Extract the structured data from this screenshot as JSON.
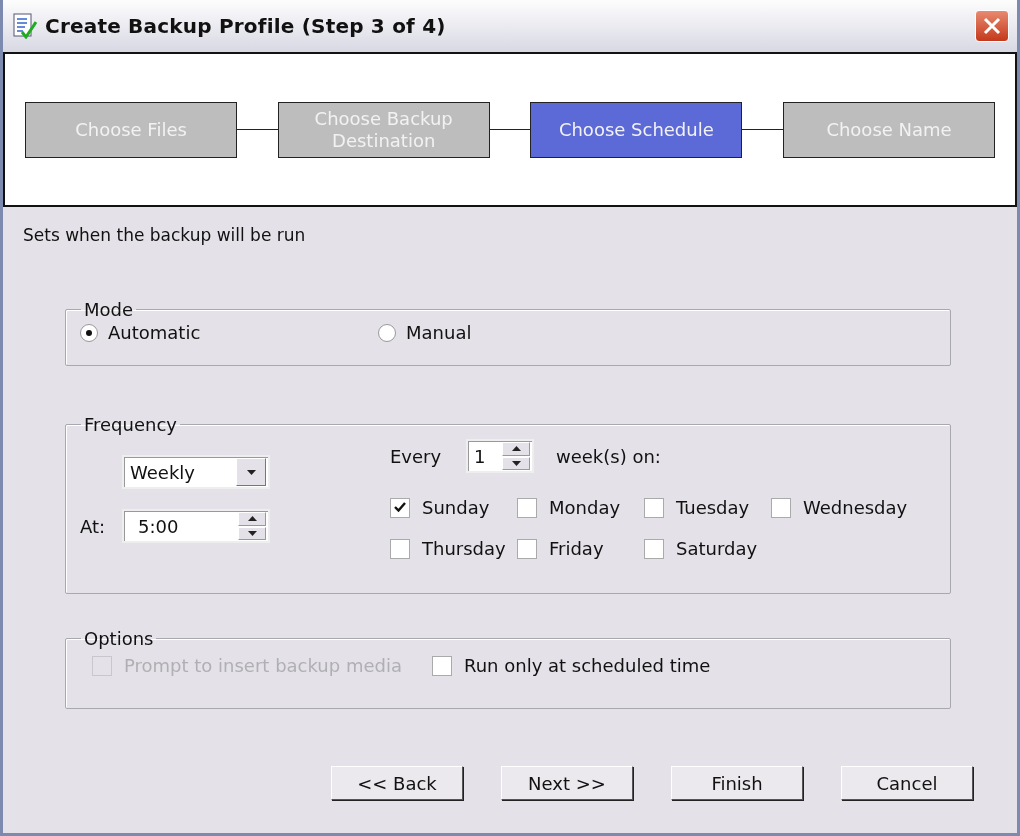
{
  "window": {
    "title": "Create Backup Profile (Step 3 of 4)"
  },
  "steps": [
    {
      "label": "Choose Files",
      "selected": false
    },
    {
      "label": "Choose Backup Destination",
      "selected": false
    },
    {
      "label": "Choose Schedule",
      "selected": true
    },
    {
      "label": "Choose Name",
      "selected": false
    }
  ],
  "description": "Sets when the backup will be run",
  "mode": {
    "title": "Mode",
    "options": [
      {
        "label": "Automatic",
        "selected": true
      },
      {
        "label": "Manual",
        "selected": false
      }
    ]
  },
  "frequency": {
    "title": "Frequency",
    "period": "Weekly",
    "at_label": "At:",
    "time": "5:00",
    "every_label": "Every",
    "every_value": "1",
    "unit_label": "week(s) on:",
    "days": [
      {
        "label": "Sunday",
        "checked": true
      },
      {
        "label": "Monday",
        "checked": false
      },
      {
        "label": "Tuesday",
        "checked": false
      },
      {
        "label": "Wednesday",
        "checked": false
      },
      {
        "label": "Thursday",
        "checked": false
      },
      {
        "label": "Friday",
        "checked": false
      },
      {
        "label": "Saturday",
        "checked": false
      }
    ]
  },
  "options": {
    "title": "Options",
    "items": [
      {
        "label": "Prompt to insert backup media",
        "checked": false,
        "disabled": true
      },
      {
        "label": "Run only at scheduled time",
        "checked": false,
        "disabled": false
      }
    ]
  },
  "buttons": [
    "<< Back",
    "Next >>",
    "Finish",
    "Cancel"
  ]
}
